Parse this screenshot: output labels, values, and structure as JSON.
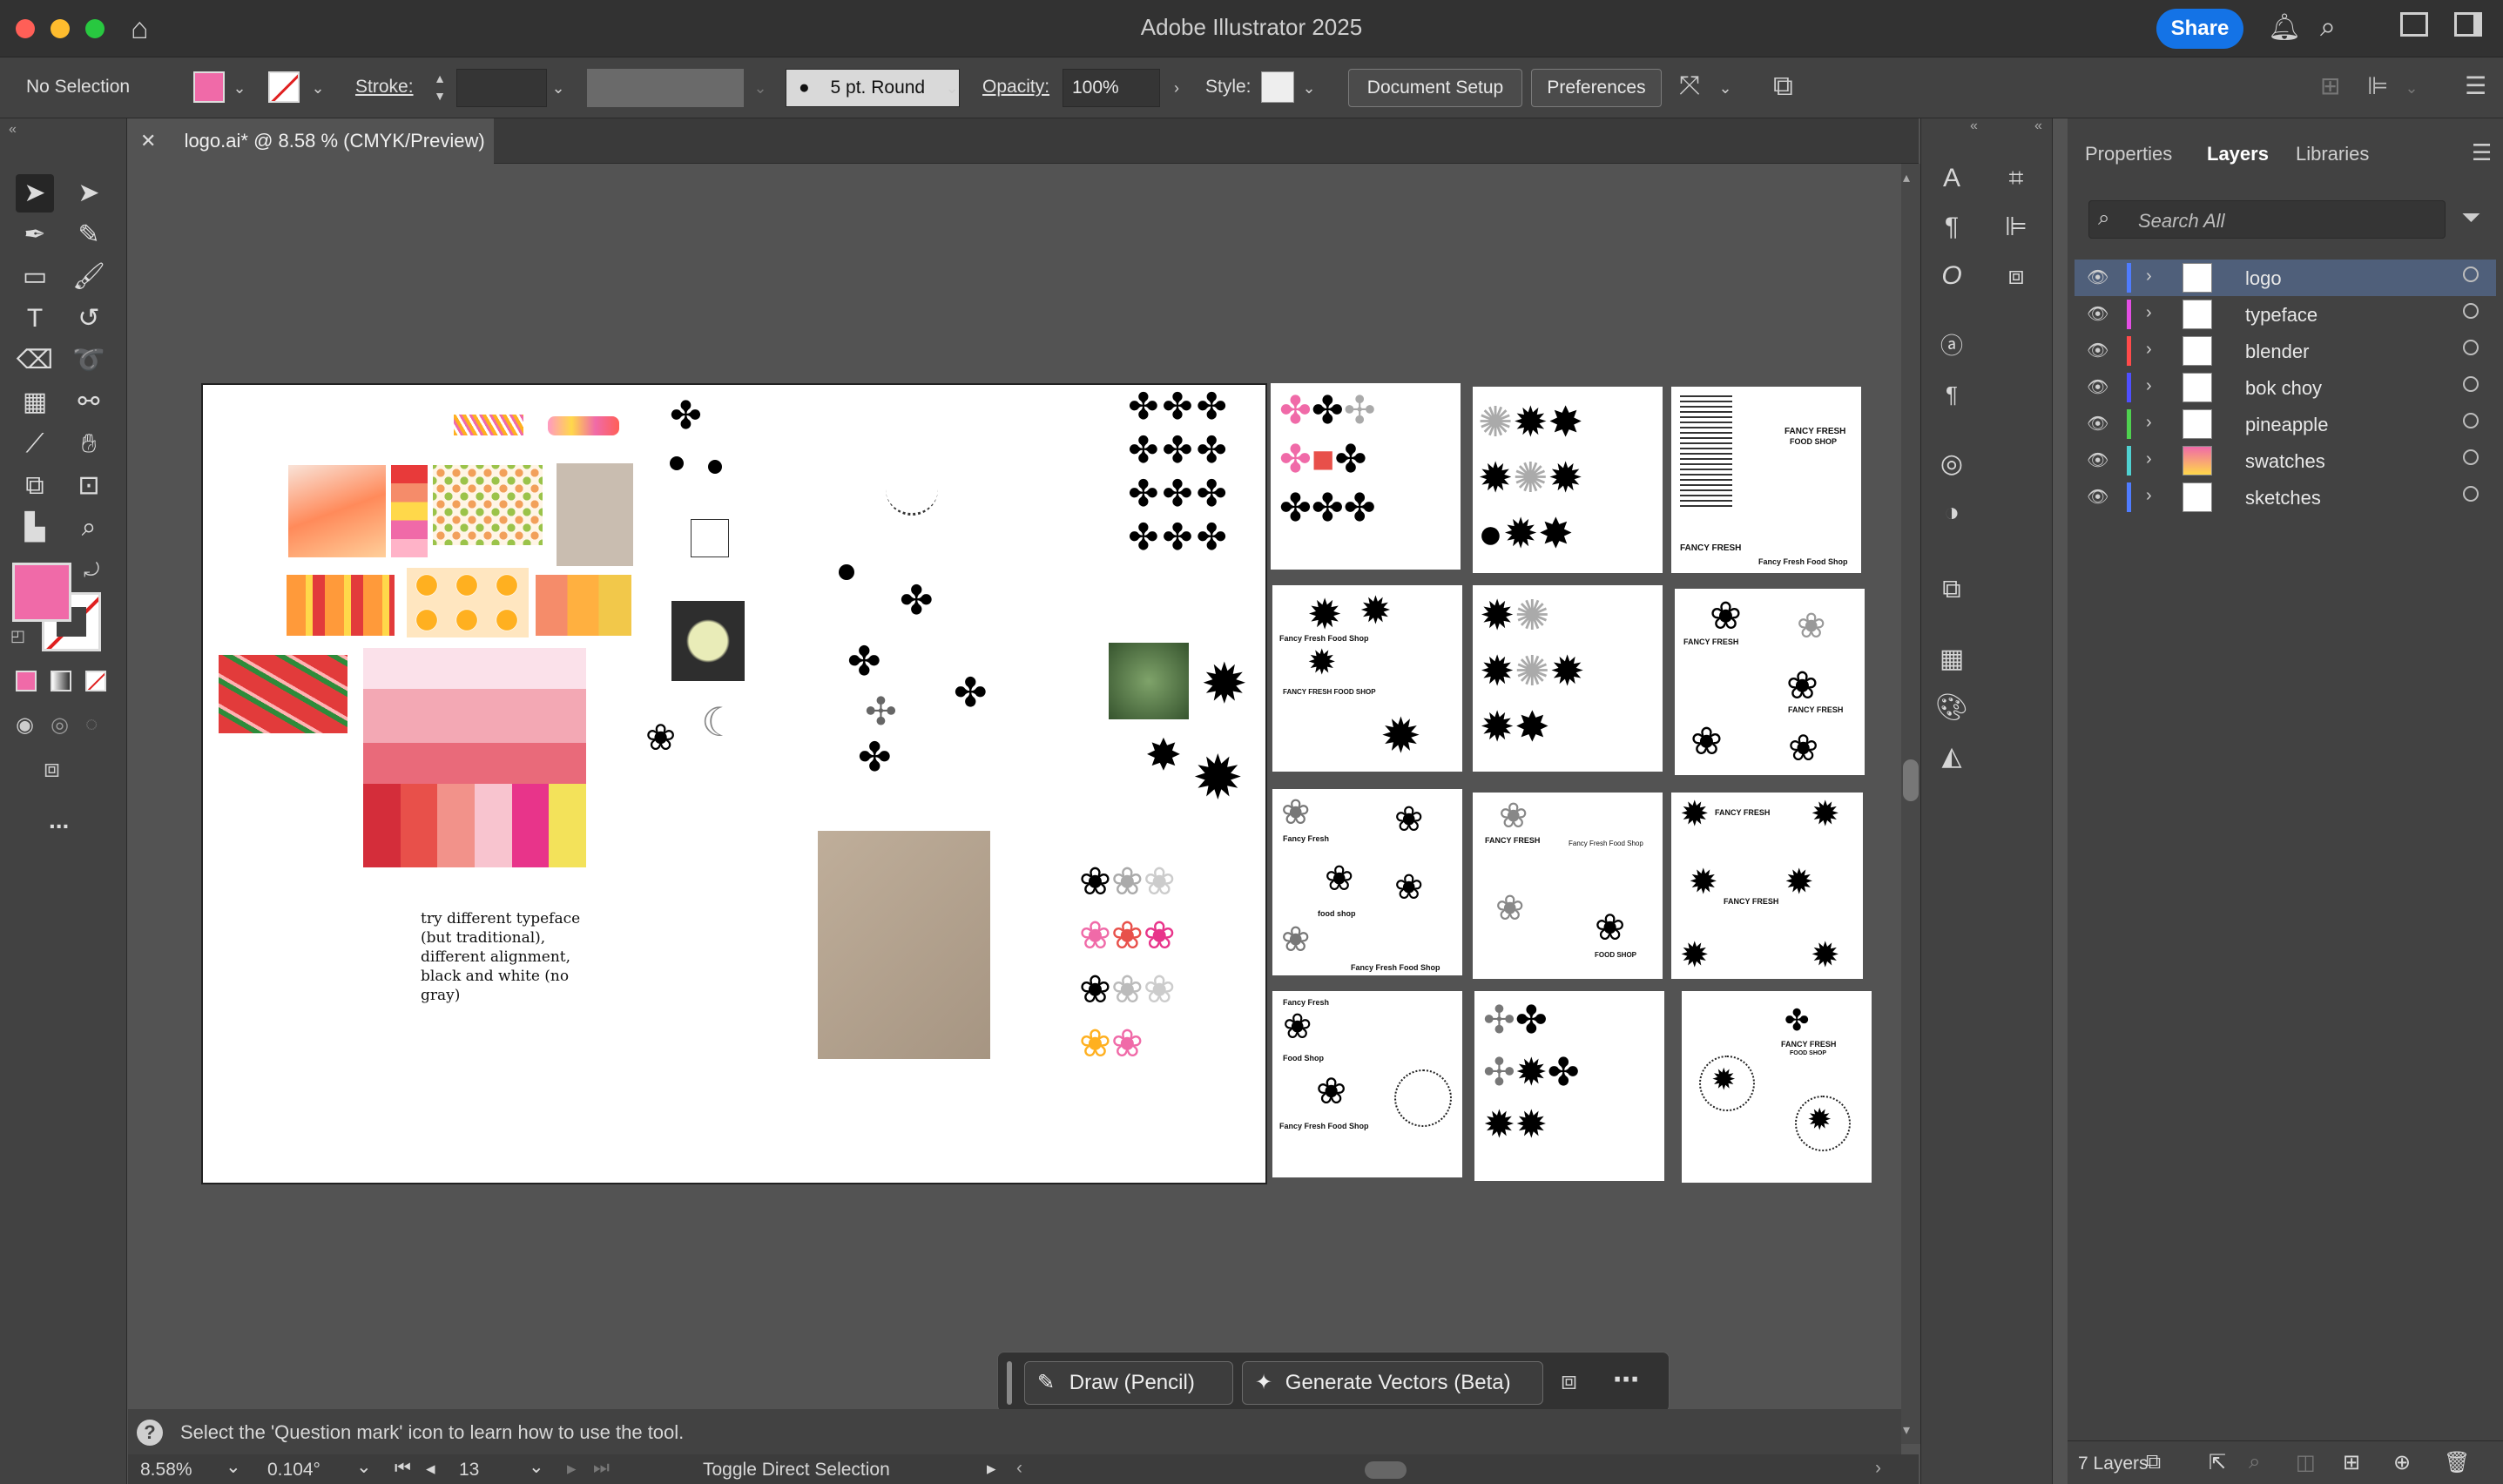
{
  "window": {
    "title": "Adobe Illustrator 2025",
    "share_label": "Share",
    "traffic_colors": [
      "#ff5f57",
      "#febc2e",
      "#28c840"
    ]
  },
  "control_bar": {
    "selection_label": "No Selection",
    "fill_color": "#f06aa8",
    "stroke_label": "Stroke:",
    "brush_label": "5 pt. Round",
    "opacity_label": "Opacity:",
    "opacity_value": "100%",
    "style_label": "Style:",
    "document_setup_label": "Document Setup",
    "preferences_label": "Preferences"
  },
  "document": {
    "tab_title": "logo.ai* @ 8.58 % (CMYK/Preview)"
  },
  "toolbar": {
    "fill_color": "#f06aa8",
    "more_label": "..."
  },
  "canvas": {
    "note_text": "try different typeface (but traditional), different alignment, black and white (no gray)",
    "draw_pencil_label": "Draw (Pencil)",
    "generate_vectors_label": "Generate Vectors (Beta)",
    "palette_colors": [
      "#f06aa8",
      "#ff9a5a",
      "#ffd84a",
      "#e23b3b",
      "#8bc34a",
      "#f7c6d6"
    ],
    "swatch_strip": [
      "#d42d3a",
      "#e8504a",
      "#f2928a",
      "#f8c4cf",
      "#e8348a",
      "#f3e25a"
    ],
    "logo_texts": {
      "fancy_fresh": "Fancy Fresh",
      "food_shop": "Food Shop",
      "fancy_fresh_food_shop": "Fancy Fresh Food Shop",
      "fancy_fresh_caps": "FANCY FRESH",
      "food_shop_caps": "FOOD SHOP",
      "food_shop_lower": "food shop",
      "fancy_fresh_food_shop_caps": "FANCY FRESH FOOD SHOP"
    }
  },
  "status": {
    "hint": "Select the 'Question mark' icon to learn how to use the tool.",
    "zoom": "8.58%",
    "rotation": "0.104°",
    "artboard_number": "13",
    "tool_status": "Toggle Direct Selection",
    "layers_count": "7 Layers"
  },
  "panel": {
    "tabs": [
      "Properties",
      "Layers",
      "Libraries"
    ],
    "search_placeholder": "Search All",
    "layers": [
      {
        "name": "logo",
        "color": "#4f7cff",
        "selected": true
      },
      {
        "name": "typeface",
        "color": "#e34ee3"
      },
      {
        "name": "blender",
        "color": "#ff4a4a"
      },
      {
        "name": "bok choy",
        "color": "#4f4fff"
      },
      {
        "name": "pineapple",
        "color": "#4fd14f"
      },
      {
        "name": "swatches",
        "color": "#4fd1d1"
      },
      {
        "name": "sketches",
        "color": "#4f7cff"
      }
    ]
  }
}
